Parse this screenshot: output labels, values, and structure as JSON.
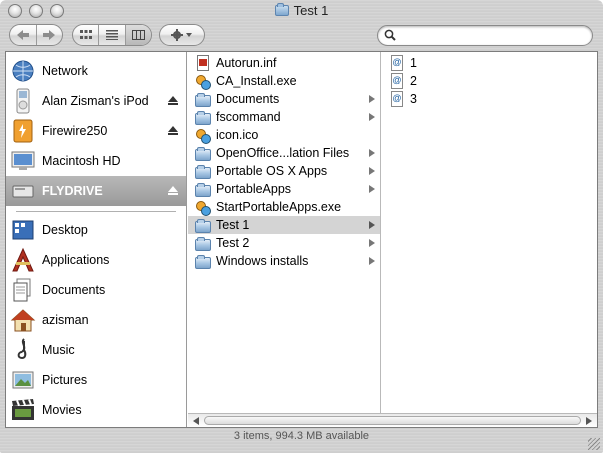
{
  "window": {
    "title": "Test 1"
  },
  "search": {
    "placeholder": "",
    "value": ""
  },
  "sidebar": {
    "devices": [
      {
        "label": "Network",
        "icon": "network-icon",
        "eject": false
      },
      {
        "label": "Alan Zisman's iPod",
        "icon": "ipod-icon",
        "eject": true
      },
      {
        "label": "Firewire250",
        "icon": "firewire-drive-icon",
        "eject": true
      },
      {
        "label": "Macintosh HD",
        "icon": "hard-drive-icon",
        "eject": false
      },
      {
        "label": "FLYDRIVE",
        "icon": "usb-drive-icon",
        "eject": true,
        "selected": true
      }
    ],
    "places": [
      {
        "label": "Desktop",
        "icon": "desktop-icon"
      },
      {
        "label": "Applications",
        "icon": "applications-icon"
      },
      {
        "label": "Documents",
        "icon": "documents-icon"
      },
      {
        "label": "azisman",
        "icon": "home-icon"
      },
      {
        "label": "Music",
        "icon": "music-icon"
      },
      {
        "label": "Pictures",
        "icon": "pictures-icon"
      },
      {
        "label": "Movies",
        "icon": "movies-icon"
      }
    ]
  },
  "column1": [
    {
      "label": "Autorun.inf",
      "type": "doc",
      "folder": false
    },
    {
      "label": "CA_Install.exe",
      "type": "exe",
      "folder": false
    },
    {
      "label": "Documents",
      "type": "folder",
      "folder": true
    },
    {
      "label": "fscommand",
      "type": "folder",
      "folder": true
    },
    {
      "label": "icon.ico",
      "type": "exe",
      "folder": false
    },
    {
      "label": "OpenOffice...lation Files",
      "type": "folder",
      "folder": true
    },
    {
      "label": "Portable OS X Apps",
      "type": "folder",
      "folder": true
    },
    {
      "label": "PortableApps",
      "type": "folder",
      "folder": true
    },
    {
      "label": "StartPortableApps.exe",
      "type": "exe",
      "folder": false
    },
    {
      "label": "Test 1",
      "type": "folder",
      "folder": true,
      "selected": true
    },
    {
      "label": "Test 2",
      "type": "folder",
      "folder": true
    },
    {
      "label": "Windows installs",
      "type": "folder",
      "folder": true
    }
  ],
  "column2": [
    {
      "label": "1",
      "type": "alias"
    },
    {
      "label": "2",
      "type": "alias"
    },
    {
      "label": "3",
      "type": "alias"
    }
  ],
  "status": {
    "text": "3 items, 994.3 MB available"
  }
}
